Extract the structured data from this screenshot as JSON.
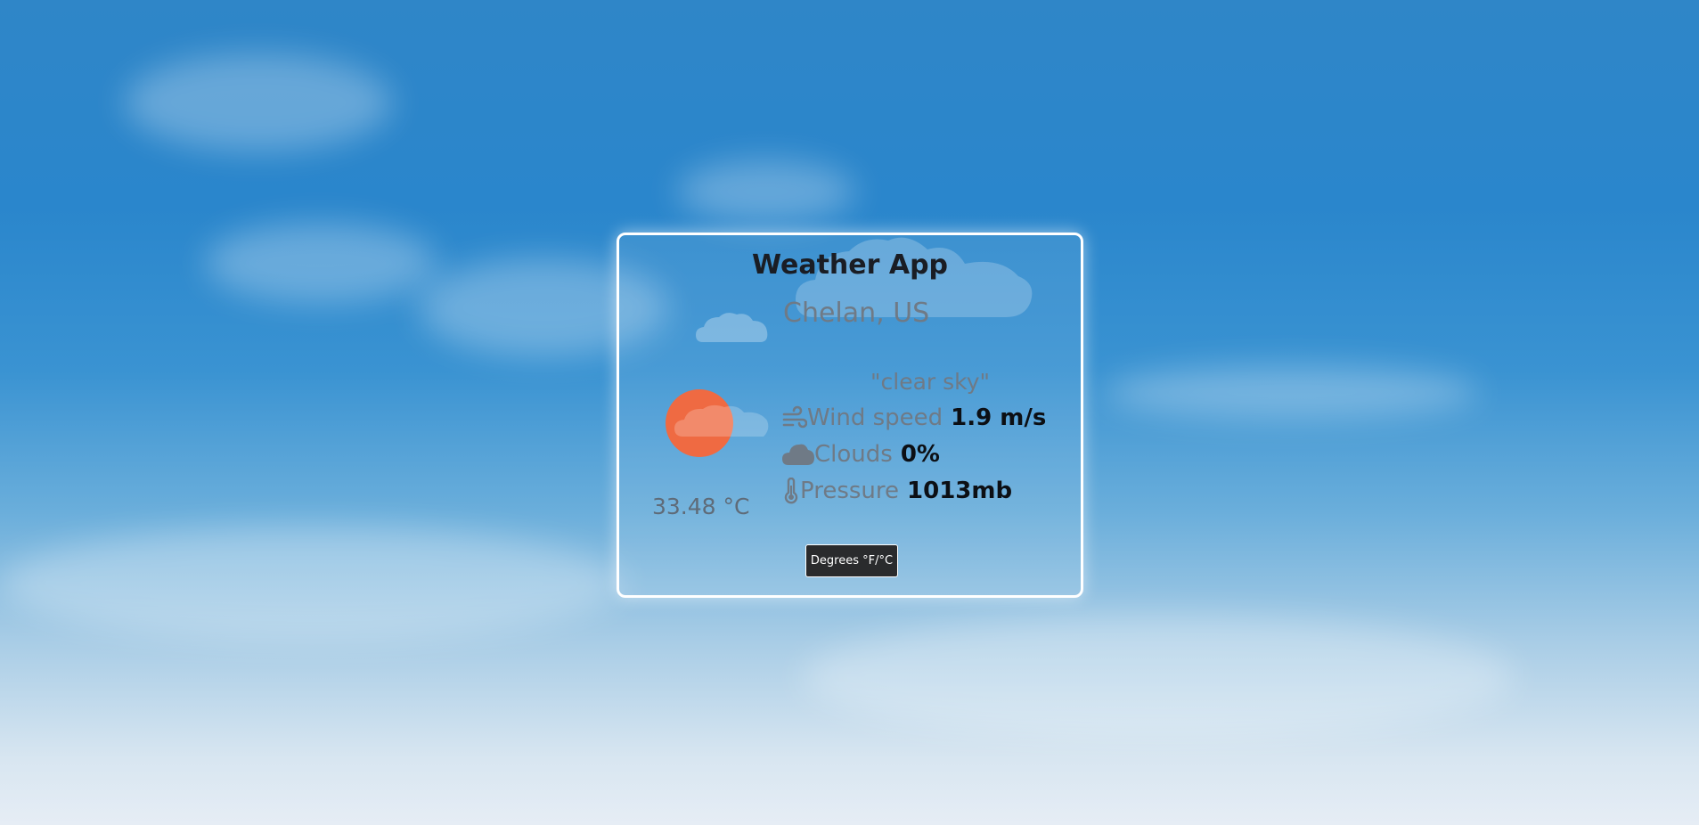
{
  "app": {
    "title": "Weather App"
  },
  "location": {
    "text": "Chelan, US"
  },
  "weather": {
    "description": "\"clear sky\"",
    "temperature": "33.48 °C",
    "icon": "clear-sky-icon"
  },
  "details": {
    "wind": {
      "label": "Wind speed",
      "value": "1.9 m/s",
      "icon": "wind-icon"
    },
    "clouds": {
      "label": "Clouds",
      "value": "0%",
      "icon": "cloud-icon"
    },
    "pressure": {
      "label": "Pressure",
      "value": "1013mb",
      "icon": "thermometer-icon"
    }
  },
  "controls": {
    "toggle_units_label": "Degrees °F/°C"
  },
  "colors": {
    "sun": "#ef6a42",
    "button_bg": "#2a2b2d",
    "card_border": "#ffffff",
    "muted_text": "#6f7a86",
    "strong_text": "#0c0f14"
  }
}
